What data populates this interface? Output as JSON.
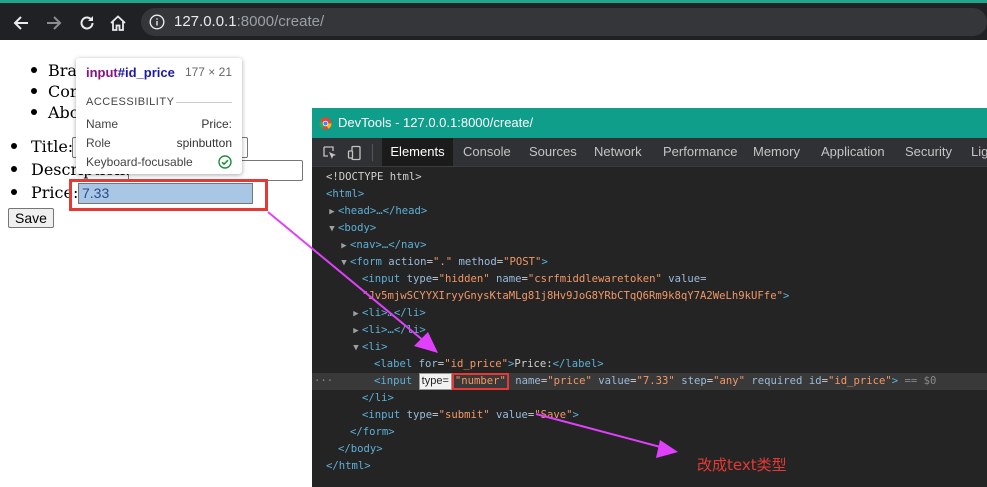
{
  "browser": {
    "url_host": "127.0.0.1",
    "url_rest": ":8000/create/"
  },
  "page": {
    "nav_items": [
      "Brand",
      "Contact",
      "About"
    ],
    "form": {
      "title_label": "Title:",
      "description_label": "Description:",
      "price_label": "Price:",
      "price_value": "7.33",
      "save_label": "Save"
    }
  },
  "tooltip": {
    "tag": "input",
    "id": "#id_price",
    "size": "177 × 21",
    "section": "ACCESSIBILITY",
    "rows": [
      {
        "key": "Name",
        "value": "Price:"
      },
      {
        "key": "Role",
        "value": "spinbutton"
      },
      {
        "key": "Keyboard-focusable",
        "value": ""
      }
    ]
  },
  "devtools": {
    "title": "DevTools - 127.0.0.1:8000/create/",
    "tabs": [
      "Elements",
      "Console",
      "Sources",
      "Network",
      "Performance",
      "Memory",
      "Application",
      "Security",
      "Lighthouse"
    ],
    "active_tab": "Elements",
    "code": {
      "doctype": "<!DOCTYPE html>",
      "html_open": "<html>",
      "head": "<head>…</head>",
      "body_open": "<body>",
      "nav": "<nav>…</nav>",
      "form_tag": "form",
      "form_attr1_name": "action",
      "form_attr1_value": "\".\"",
      "form_attr2_name": "method",
      "form_attr2_value": "\"POST\"",
      "csrf_attrs": {
        "type": "\"hidden\"",
        "name": "\"csrfmiddlewaretoken\"",
        "value_label": "value="
      },
      "csrf_token": "\"Jv5mjwSCYYXIryyGnysKtaMLg81j8Hv9JoG8YRbCTqQ6Rm9k8qY7A2WeLh9kUFfe\"",
      "li_collapsed": "<li>…</li>",
      "li_open": "<li>",
      "label_for": "\"id_price\"",
      "label_text": "Price:",
      "input_type_hint": "type=",
      "input_type_value": "\"number\"",
      "input_rest": {
        "name": "\"price\"",
        "value": "\"7.33\"",
        "step": "\"any\"",
        "required": "required",
        "id": "\"id_price\"",
        "suffix": "== $0"
      },
      "li_close": "</li>",
      "submit_type": "\"submit\"",
      "submit_value": "\"Save\"",
      "form_close": "</form>",
      "body_close": "</body>",
      "html_close": "</html>"
    }
  },
  "annotation": {
    "note": "改成text类型",
    "color": "#e53935",
    "arrow_color": "#e040fb"
  }
}
